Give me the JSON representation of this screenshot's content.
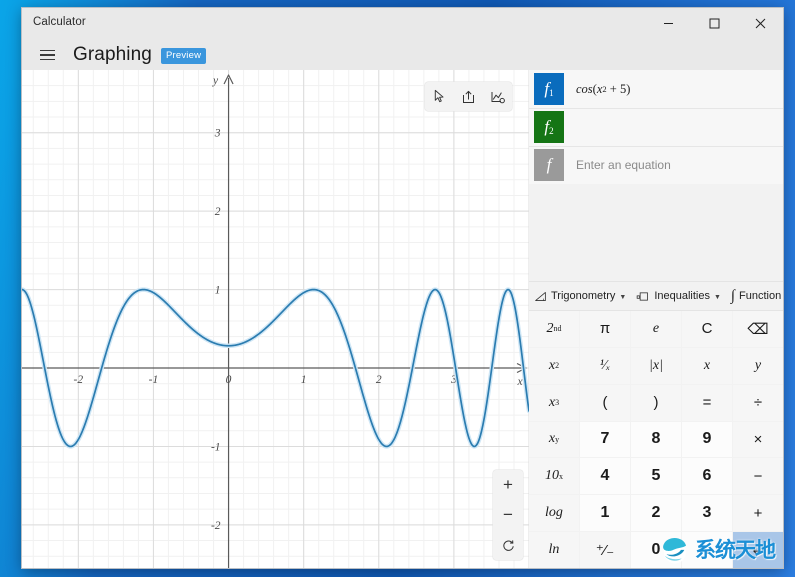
{
  "window": {
    "app_title": "Calculator",
    "controls": {
      "minimize": "minimize-icon",
      "maximize": "maximize-icon",
      "close": "close-icon"
    }
  },
  "header": {
    "menu_icon": "hamburger-icon",
    "mode_title": "Graphing",
    "badge": "Preview"
  },
  "graph_toolbar": [
    {
      "name": "pointer-tool",
      "icon": "cursor-arrow-icon"
    },
    {
      "name": "share-tool",
      "icon": "share-icon"
    },
    {
      "name": "graph-settings-tool",
      "icon": "graph-settings-icon"
    }
  ],
  "zoom_controls": [
    {
      "name": "zoom-in",
      "label": "+"
    },
    {
      "name": "zoom-out",
      "label": "−"
    },
    {
      "name": "reset-view",
      "label": "reset-icon"
    }
  ],
  "equations": [
    {
      "tile": "f",
      "index": "1",
      "color": "#0a6cbd",
      "value": "cos(x² + 5)",
      "placeholder": ""
    },
    {
      "tile": "f",
      "index": "2",
      "color": "#157515",
      "value": "",
      "placeholder": ""
    },
    {
      "tile": "f",
      "index": "",
      "color": "#9a9a9a",
      "value": "",
      "placeholder": "Enter an equation"
    }
  ],
  "function_bar": [
    {
      "label": "Trigonometry",
      "icon": "trig-icon",
      "has_caret": true
    },
    {
      "label": "Inequalities",
      "icon": "inequalities-icon",
      "has_caret": true
    },
    {
      "label": "Function",
      "icon": "function-icon",
      "has_caret": false
    }
  ],
  "keypad": [
    {
      "label": "2",
      "sup": "nd",
      "name": "key-second",
      "type": "fn"
    },
    {
      "label": "π",
      "name": "key-pi",
      "type": "op"
    },
    {
      "label": "e",
      "name": "key-e",
      "type": "fn"
    },
    {
      "label": "C",
      "name": "key-clear",
      "type": "op"
    },
    {
      "label": "⌫",
      "name": "key-backspace",
      "type": "op"
    },
    {
      "label": "x",
      "sup": "2",
      "name": "key-x-squared",
      "type": "fn"
    },
    {
      "label": "¹⁄ₓ",
      "name": "key-reciprocal",
      "type": "fn"
    },
    {
      "label": "|x|",
      "name": "key-abs",
      "type": "fn"
    },
    {
      "label": "x",
      "name": "key-x",
      "type": "fn"
    },
    {
      "label": "y",
      "name": "key-y",
      "type": "fn"
    },
    {
      "label": "x",
      "sup": "3",
      "name": "key-x-cubed",
      "type": "fn"
    },
    {
      "label": "(",
      "name": "key-open-paren",
      "type": "op"
    },
    {
      "label": ")",
      "name": "key-close-paren",
      "type": "op"
    },
    {
      "label": "=",
      "name": "key-equals",
      "type": "op"
    },
    {
      "label": "÷",
      "name": "key-divide",
      "type": "op"
    },
    {
      "label": "x",
      "sup": "y",
      "name": "key-x-power-y",
      "type": "fn"
    },
    {
      "label": "7",
      "name": "key-7",
      "type": "num"
    },
    {
      "label": "8",
      "name": "key-8",
      "type": "num"
    },
    {
      "label": "9",
      "name": "key-9",
      "type": "num"
    },
    {
      "label": "×",
      "name": "key-multiply",
      "type": "op"
    },
    {
      "label": "10",
      "sup": "x",
      "name": "key-ten-power-x",
      "type": "fn"
    },
    {
      "label": "4",
      "name": "key-4",
      "type": "num"
    },
    {
      "label": "5",
      "name": "key-5",
      "type": "num"
    },
    {
      "label": "6",
      "name": "key-6",
      "type": "num"
    },
    {
      "label": "−",
      "name": "key-subtract",
      "type": "op"
    },
    {
      "label": "log",
      "name": "key-log",
      "type": "fn"
    },
    {
      "label": "1",
      "name": "key-1",
      "type": "num"
    },
    {
      "label": "2",
      "name": "key-2",
      "type": "num"
    },
    {
      "label": "3",
      "name": "key-3",
      "type": "num"
    },
    {
      "label": "+",
      "name": "key-add",
      "type": "op"
    },
    {
      "label": "ln",
      "name": "key-ln",
      "type": "fn"
    },
    {
      "label": "⁺⁄₋",
      "name": "key-sign",
      "type": "op"
    },
    {
      "label": "0",
      "name": "key-0",
      "type": "num"
    },
    {
      "label": ".",
      "name": "key-decimal",
      "type": "num"
    },
    {
      "label": "↵",
      "name": "key-enter",
      "type": "enter"
    }
  ],
  "watermark": {
    "text": "系统天地",
    "logo": "swirl-logo-icon"
  },
  "chart_data": {
    "type": "line",
    "title": "",
    "expression": "cos(x^2 + 5)",
    "xlabel": "x",
    "ylabel": "y",
    "xlim": [
      -2.75,
      4.0
    ],
    "ylim": [
      -2.55,
      3.8
    ],
    "xticks": [
      -2,
      -1,
      0,
      1,
      2,
      3
    ],
    "yticks": [
      -2,
      -1,
      1,
      2,
      3
    ],
    "grid": true,
    "minor_grid": true,
    "legend": "none",
    "series": [
      {
        "name": "f1",
        "color": "#2b7cb0",
        "formula": "cos(x*x + 5)",
        "x_start": -2.75,
        "x_end": 4.0,
        "samples": 1400
      }
    ],
    "notable_points": {
      "maxima_y": 1,
      "minima_y": -1,
      "y_at_x0": 0.2837,
      "visible_maxima_x": [
        -1.19,
        1.19,
        2.68,
        3.51
      ],
      "visible_minima_x": [
        -2.17,
        2.17,
        3.13,
        3.82
      ]
    }
  }
}
